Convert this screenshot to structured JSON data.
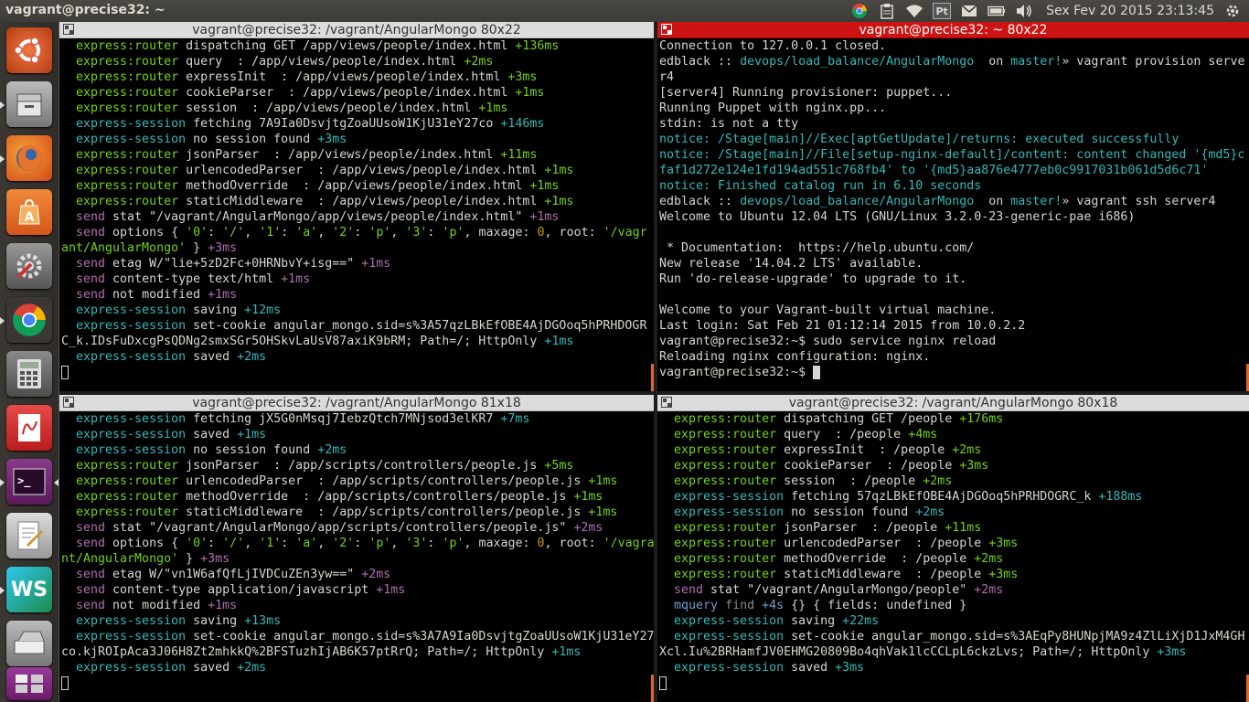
{
  "topbar": {
    "title": "vagrant@precise32: ~",
    "clock": "Sex Fev 20 2015 23:13:45",
    "pt": "Pt",
    "icons": [
      "chrome-icon",
      "clipboard-icon",
      "wifi-icon",
      "keyboard-layout-icon",
      "mail-icon",
      "battery-icon",
      "volume-icon"
    ]
  },
  "launcher": {
    "apps": [
      "ubuntu-dash",
      "file-manager",
      "firefox",
      "software-center",
      "system-settings",
      "chrome",
      "calculator",
      "document-viewer",
      "terminal",
      "text-editor",
      "webstorm",
      "scanner",
      "workspace-switcher"
    ]
  },
  "terminals": [
    {
      "title": "vagrant@precise32: /vagrant/AngularMongo 80x22",
      "lines": [
        [
          [
            "  express:router ",
            "g"
          ],
          [
            "dispatching GET /app/views/people/index.html ",
            "w"
          ],
          [
            "+136ms",
            "g"
          ]
        ],
        [
          [
            "  express:router ",
            "g"
          ],
          [
            "query  : /app/views/people/index.html ",
            "w"
          ],
          [
            "+2ms",
            "g"
          ]
        ],
        [
          [
            "  express:router ",
            "g"
          ],
          [
            "expressInit  : /app/views/people/index.html ",
            "w"
          ],
          [
            "+3ms",
            "g"
          ]
        ],
        [
          [
            "  express:router ",
            "g"
          ],
          [
            "cookieParser  : /app/views/people/index.html ",
            "w"
          ],
          [
            "+1ms",
            "g"
          ]
        ],
        [
          [
            "  express:router ",
            "g"
          ],
          [
            "session  : /app/views/people/index.html ",
            "w"
          ],
          [
            "+1ms",
            "g"
          ]
        ],
        [
          [
            "  express-session ",
            "c"
          ],
          [
            "fetching 7A9Ia0DsvjtgZoaUUsoW1KjU31eY27co ",
            "w"
          ],
          [
            "+146ms",
            "c"
          ]
        ],
        [
          [
            "  express-session ",
            "c"
          ],
          [
            "no session found ",
            "w"
          ],
          [
            "+3ms",
            "c"
          ]
        ],
        [
          [
            "  express:router ",
            "g"
          ],
          [
            "jsonParser  : /app/views/people/index.html ",
            "w"
          ],
          [
            "+11ms",
            "g"
          ]
        ],
        [
          [
            "  express:router ",
            "g"
          ],
          [
            "urlencodedParser  : /app/views/people/index.html ",
            "w"
          ],
          [
            "+1ms",
            "g"
          ]
        ],
        [
          [
            "  express:router ",
            "g"
          ],
          [
            "methodOverride  : /app/views/people/index.html ",
            "w"
          ],
          [
            "+1ms",
            "g"
          ]
        ],
        [
          [
            "  express:router ",
            "g"
          ],
          [
            "staticMiddleware  : /app/views/people/index.html ",
            "w"
          ],
          [
            "+1ms",
            "g"
          ]
        ],
        [
          [
            "  send ",
            "m"
          ],
          [
            "stat \"/vagrant/AngularMongo/app/views/people/index.html\" ",
            "w"
          ],
          [
            "+1ms",
            "m"
          ]
        ],
        [
          [
            "  send ",
            "m"
          ],
          [
            "options { ",
            "w"
          ],
          [
            "'0'",
            "g"
          ],
          [
            ": ",
            "w"
          ],
          [
            "'/'",
            "g"
          ],
          [
            ", ",
            "w"
          ],
          [
            "'1'",
            "g"
          ],
          [
            ": ",
            "w"
          ],
          [
            "'a'",
            "g"
          ],
          [
            ", ",
            "w"
          ],
          [
            "'2'",
            "g"
          ],
          [
            ": ",
            "w"
          ],
          [
            "'p'",
            "g"
          ],
          [
            ", ",
            "w"
          ],
          [
            "'3'",
            "g"
          ],
          [
            ": ",
            "w"
          ],
          [
            "'p'",
            "g"
          ],
          [
            ", maxage: ",
            "w"
          ],
          [
            "0",
            "y"
          ],
          [
            ", root: ",
            "w"
          ],
          [
            "'/vagr",
            "g"
          ]
        ],
        [
          [
            "ant/AngularMongo'",
            "g"
          ],
          [
            " } ",
            "w"
          ],
          [
            "+3ms",
            "m"
          ]
        ],
        [
          [
            "  send ",
            "m"
          ],
          [
            "etag W/\"lie+5zD2Fc+0HRNbvY+isg==\" ",
            "w"
          ],
          [
            "+1ms",
            "m"
          ]
        ],
        [
          [
            "  send ",
            "m"
          ],
          [
            "content-type text/html ",
            "w"
          ],
          [
            "+1ms",
            "m"
          ]
        ],
        [
          [
            "  send ",
            "m"
          ],
          [
            "not modified ",
            "w"
          ],
          [
            "+1ms",
            "m"
          ]
        ],
        [
          [
            "  express-session ",
            "c"
          ],
          [
            "saving ",
            "w"
          ],
          [
            "+12ms",
            "c"
          ]
        ],
        [
          [
            "  express-session ",
            "c"
          ],
          [
            "set-cookie angular_mongo.sid=s%3A57qzLBkEfOBE4AjDGOoq5hPRHDOGR",
            "w"
          ]
        ],
        [
          [
            "C_k.IDsFuDxcgPsQDNg2smxSGr5OHSkvLaUsV87axiK9bRM; Path=/; HttpOnly ",
            "w"
          ],
          [
            "+1ms",
            "c"
          ]
        ],
        [
          [
            "  express-session ",
            "c"
          ],
          [
            "saved ",
            "w"
          ],
          [
            "+2ms",
            "c"
          ]
        ],
        [
          [
            "",
            "cursor-hollow"
          ]
        ]
      ]
    },
    {
      "title": "vagrant@precise32: ~ 80x22",
      "lines": [
        [
          [
            "Connection to 127.0.0.1 closed.",
            "w"
          ]
        ],
        [
          [
            "edblack :: ",
            "w"
          ],
          [
            "devops/load_balance/AngularMongo ",
            "c"
          ],
          [
            " on ",
            "w"
          ],
          [
            "master!",
            "c"
          ],
          [
            "» vagrant provision serve",
            "w"
          ]
        ],
        [
          [
            "r4",
            "w"
          ]
        ],
        [
          [
            "[server4] Running provisioner: puppet...",
            "w"
          ]
        ],
        [
          [
            "Running Puppet with nginx.pp...",
            "w"
          ]
        ],
        [
          [
            "stdin: is not a tty",
            "w"
          ]
        ],
        [
          [
            "notice: /Stage[main]//Exec[aptGetUpdate]/returns: executed successfully",
            "c"
          ]
        ],
        [
          [
            "notice: /Stage[main]//File[setup-nginx-default]/content: content changed '{md5}c",
            "c"
          ]
        ],
        [
          [
            "faf1d272e124e1fd194ad551c768fb4' to '{md5}aa876e4777eb0c9917031b061d5d6c71'",
            "c"
          ]
        ],
        [
          [
            "notice: Finished catalog run in 6.10 seconds",
            "c"
          ]
        ],
        [
          [
            "edblack :: ",
            "w"
          ],
          [
            "devops/load_balance/AngularMongo ",
            "c"
          ],
          [
            " on ",
            "w"
          ],
          [
            "master!",
            "c"
          ],
          [
            "» vagrant ssh server4",
            "w"
          ]
        ],
        [
          [
            "Welcome to Ubuntu 12.04 LTS (GNU/Linux 3.2.0-23-generic-pae i686)",
            "w"
          ]
        ],
        [
          [
            "",
            "w"
          ]
        ],
        [
          [
            " * Documentation:  https://help.ubuntu.com/",
            "w"
          ]
        ],
        [
          [
            "New release '14.04.2 LTS' available.",
            "w"
          ]
        ],
        [
          [
            "Run 'do-release-upgrade' to upgrade to it.",
            "w"
          ]
        ],
        [
          [
            "",
            "w"
          ]
        ],
        [
          [
            "Welcome to your Vagrant-built virtual machine.",
            "w"
          ]
        ],
        [
          [
            "Last login: Sat Feb 21 01:12:14 2015 from 10.0.2.2",
            "w"
          ]
        ],
        [
          [
            "vagrant@precise32:~$ sudo service nginx reload",
            "w"
          ]
        ],
        [
          [
            "Reloading nginx configuration: nginx.",
            "w"
          ]
        ],
        [
          [
            "vagrant@precise32:~$ ",
            "w"
          ],
          [
            "",
            "cursor"
          ]
        ]
      ]
    },
    {
      "title": "vagrant@precise32: /vagrant/AngularMongo 81x18",
      "lines": [
        [
          [
            "  express-session ",
            "c"
          ],
          [
            "fetching jX5G0nMsqj7IebzQtch7MNjsod3elKR7 ",
            "w"
          ],
          [
            "+7ms",
            "c"
          ]
        ],
        [
          [
            "  express-session ",
            "c"
          ],
          [
            "saved ",
            "w"
          ],
          [
            "+1ms",
            "c"
          ]
        ],
        [
          [
            "  express-session ",
            "c"
          ],
          [
            "no session found ",
            "w"
          ],
          [
            "+2ms",
            "c"
          ]
        ],
        [
          [
            "  express:router ",
            "g"
          ],
          [
            "jsonParser  : /app/scripts/controllers/people.js ",
            "w"
          ],
          [
            "+5ms",
            "g"
          ]
        ],
        [
          [
            "  express:router ",
            "g"
          ],
          [
            "urlencodedParser  : /app/scripts/controllers/people.js ",
            "w"
          ],
          [
            "+1ms",
            "g"
          ]
        ],
        [
          [
            "  express:router ",
            "g"
          ],
          [
            "methodOverride  : /app/scripts/controllers/people.js ",
            "w"
          ],
          [
            "+1ms",
            "g"
          ]
        ],
        [
          [
            "  express:router ",
            "g"
          ],
          [
            "staticMiddleware  : /app/scripts/controllers/people.js ",
            "w"
          ],
          [
            "+1ms",
            "g"
          ]
        ],
        [
          [
            "  send ",
            "m"
          ],
          [
            "stat \"/vagrant/AngularMongo/app/scripts/controllers/people.js\" ",
            "w"
          ],
          [
            "+2ms",
            "m"
          ]
        ],
        [
          [
            "  send ",
            "m"
          ],
          [
            "options { ",
            "w"
          ],
          [
            "'0'",
            "g"
          ],
          [
            ": ",
            "w"
          ],
          [
            "'/'",
            "g"
          ],
          [
            ", ",
            "w"
          ],
          [
            "'1'",
            "g"
          ],
          [
            ": ",
            "w"
          ],
          [
            "'a'",
            "g"
          ],
          [
            ", ",
            "w"
          ],
          [
            "'2'",
            "g"
          ],
          [
            ": ",
            "w"
          ],
          [
            "'p'",
            "g"
          ],
          [
            ", ",
            "w"
          ],
          [
            "'3'",
            "g"
          ],
          [
            ": ",
            "w"
          ],
          [
            "'p'",
            "g"
          ],
          [
            ", maxage: ",
            "w"
          ],
          [
            "0",
            "y"
          ],
          [
            ", root: ",
            "w"
          ],
          [
            "'/vagra",
            "g"
          ]
        ],
        [
          [
            "nt/AngularMongo'",
            "g"
          ],
          [
            " } ",
            "w"
          ],
          [
            "+3ms",
            "m"
          ]
        ],
        [
          [
            "  send ",
            "m"
          ],
          [
            "etag W/\"vn1W6afQfLjIVDCuZEn3yw==\" ",
            "w"
          ],
          [
            "+2ms",
            "m"
          ]
        ],
        [
          [
            "  send ",
            "m"
          ],
          [
            "content-type application/javascript ",
            "w"
          ],
          [
            "+1ms",
            "m"
          ]
        ],
        [
          [
            "  send ",
            "m"
          ],
          [
            "not modified ",
            "w"
          ],
          [
            "+1ms",
            "m"
          ]
        ],
        [
          [
            "  express-session ",
            "c"
          ],
          [
            "saving ",
            "w"
          ],
          [
            "+13ms",
            "c"
          ]
        ],
        [
          [
            "  express-session ",
            "c"
          ],
          [
            "set-cookie angular_mongo.sid=s%3A7A9Ia0DsvjtgZoaUUsoW1KjU31eY27",
            "w"
          ]
        ],
        [
          [
            "co.kjROIpAca3J06H8Zt2mhkkQ%2BFSTuzhIjAB6K57ptRrQ; Path=/; HttpOnly ",
            "w"
          ],
          [
            "+1ms",
            "c"
          ]
        ],
        [
          [
            "  express-session ",
            "c"
          ],
          [
            "saved ",
            "w"
          ],
          [
            "+2ms",
            "c"
          ]
        ],
        [
          [
            "",
            "cursor-hollow"
          ]
        ]
      ]
    },
    {
      "title": "vagrant@precise32: /vagrant/AngularMongo 80x18",
      "lines": [
        [
          [
            "  express:router ",
            "g"
          ],
          [
            "dispatching GET /people ",
            "w"
          ],
          [
            "+176ms",
            "g"
          ]
        ],
        [
          [
            "  express:router ",
            "g"
          ],
          [
            "query  : /people ",
            "w"
          ],
          [
            "+4ms",
            "g"
          ]
        ],
        [
          [
            "  express:router ",
            "g"
          ],
          [
            "expressInit  : /people ",
            "w"
          ],
          [
            "+2ms",
            "g"
          ]
        ],
        [
          [
            "  express:router ",
            "g"
          ],
          [
            "cookieParser  : /people ",
            "w"
          ],
          [
            "+3ms",
            "g"
          ]
        ],
        [
          [
            "  express:router ",
            "g"
          ],
          [
            "session  : /people ",
            "w"
          ],
          [
            "+2ms",
            "g"
          ]
        ],
        [
          [
            "  express-session ",
            "c"
          ],
          [
            "fetching 57qzLBkEfOBE4AjDGOoq5hPRHDOGRC_k ",
            "w"
          ],
          [
            "+188ms",
            "c"
          ]
        ],
        [
          [
            "  express-session ",
            "c"
          ],
          [
            "no session found ",
            "w"
          ],
          [
            "+2ms",
            "c"
          ]
        ],
        [
          [
            "  express:router ",
            "g"
          ],
          [
            "jsonParser  : /people ",
            "w"
          ],
          [
            "+11ms",
            "g"
          ]
        ],
        [
          [
            "  express:router ",
            "g"
          ],
          [
            "urlencodedParser  : /people ",
            "w"
          ],
          [
            "+3ms",
            "g"
          ]
        ],
        [
          [
            "  express:router ",
            "g"
          ],
          [
            "methodOverride  : /people ",
            "w"
          ],
          [
            "+2ms",
            "g"
          ]
        ],
        [
          [
            "  express:router ",
            "g"
          ],
          [
            "staticMiddleware  : /people ",
            "w"
          ],
          [
            "+3ms",
            "g"
          ]
        ],
        [
          [
            "  send ",
            "m"
          ],
          [
            "stat \"/vagrant/AngularMongo/people\" ",
            "w"
          ],
          [
            "+2ms",
            "m"
          ]
        ],
        [
          [
            "  mquery ",
            "lb"
          ],
          [
            "find ",
            "gy"
          ],
          [
            "+4s ",
            "lb"
          ],
          [
            "{} { fields: undefined }",
            "w"
          ]
        ],
        [
          [
            "  express-session ",
            "c"
          ],
          [
            "saving ",
            "w"
          ],
          [
            "+22ms",
            "c"
          ]
        ],
        [
          [
            "  express-session ",
            "c"
          ],
          [
            "set-cookie angular_mongo.sid=s%3AEqPy8HUNpjMA9z4ZlLiXjD1JxM4GH",
            "w"
          ]
        ],
        [
          [
            "Xcl.Iu%2BRHamfJV0EHMG20809Bo4qhVak1lcCCLpL6ckzLvs; Path=/; HttpOnly ",
            "w"
          ],
          [
            "+3ms",
            "c"
          ]
        ],
        [
          [
            "  express-session ",
            "c"
          ],
          [
            "saved ",
            "w"
          ],
          [
            "+3ms",
            "c"
          ]
        ],
        [
          [
            "",
            "cursor-hollow"
          ]
        ]
      ]
    }
  ]
}
